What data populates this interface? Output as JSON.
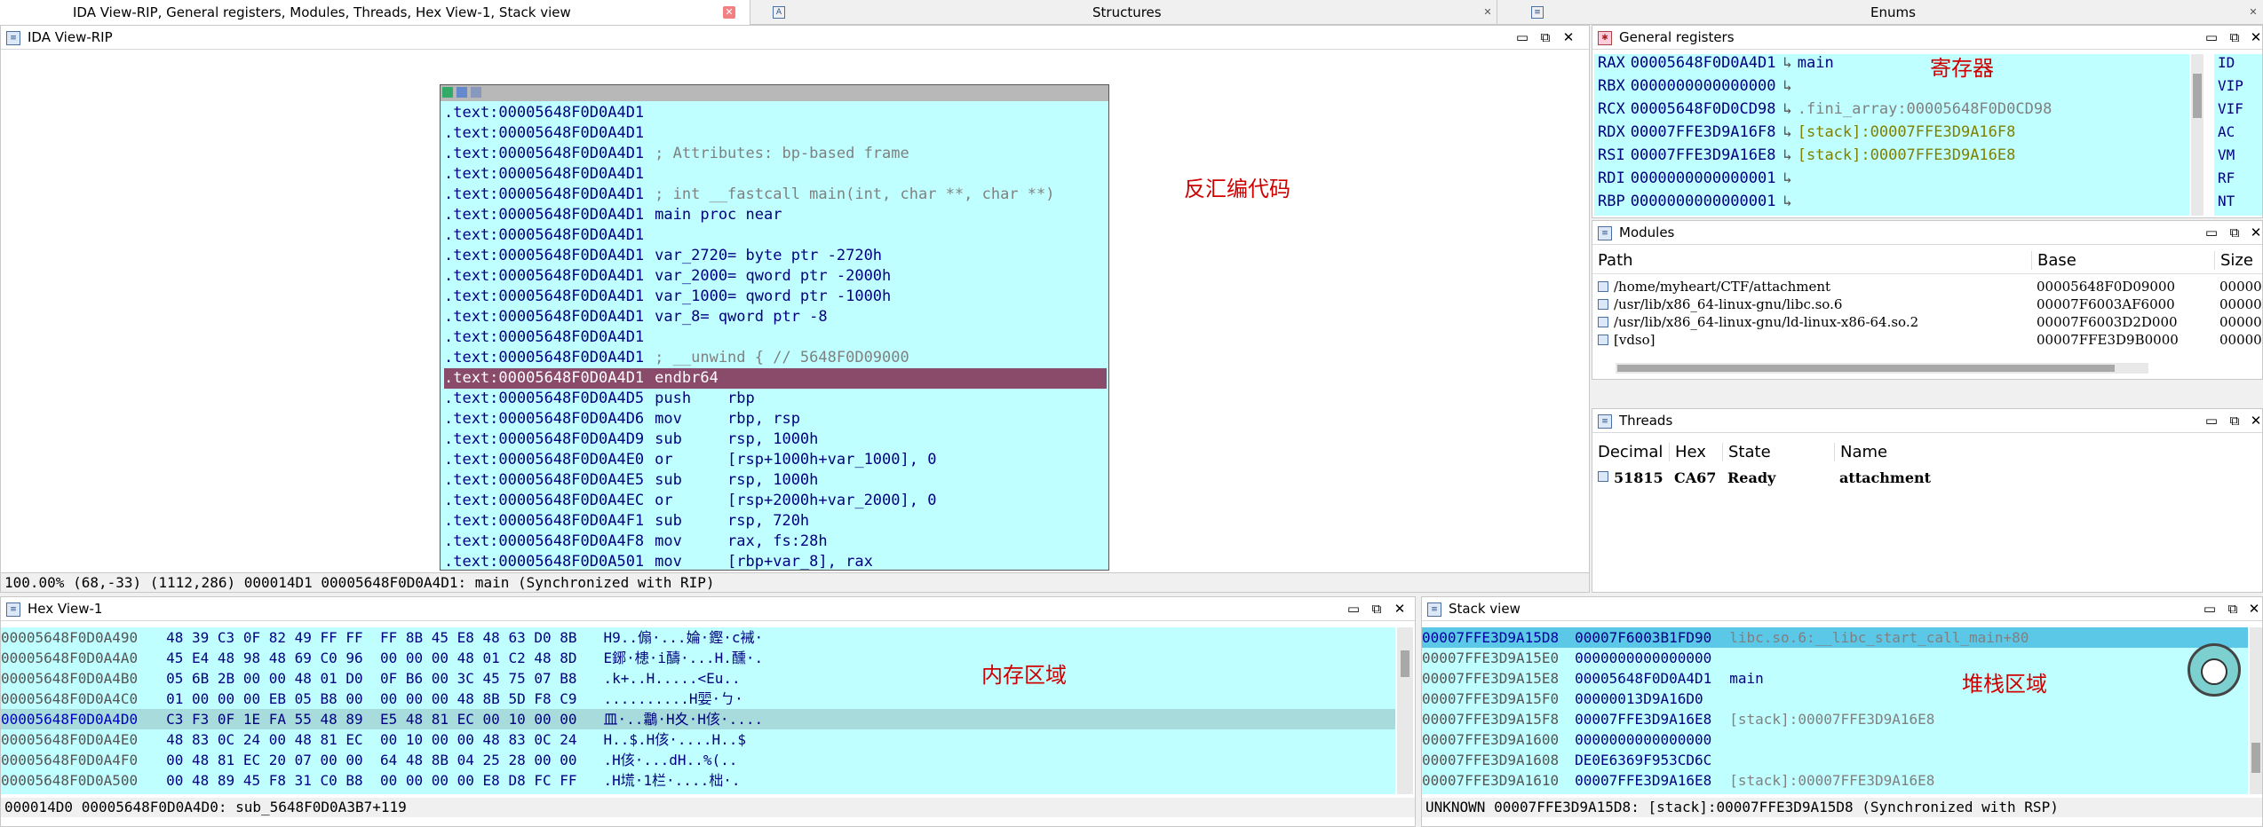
{
  "tabs": [
    {
      "label": "IDA View-RIP, General registers, Modules, Threads, Hex View-1, Stack view"
    },
    {
      "label": "Structures"
    },
    {
      "label": "Enums"
    }
  ],
  "ida_view": {
    "title": "IDA View-RIP",
    "annotation": "反汇编代码",
    "lines": [
      {
        "addr": ".text:00005648F0D0A4D1",
        "text": ""
      },
      {
        "addr": ".text:00005648F0D0A4D1",
        "text": ""
      },
      {
        "addr": ".text:00005648F0D0A4D1",
        "text": "; Attributes: bp-based frame"
      },
      {
        "addr": ".text:00005648F0D0A4D1",
        "text": ""
      },
      {
        "addr": ".text:00005648F0D0A4D1",
        "text": "; int __fastcall main(int, char **, char **)"
      },
      {
        "addr": ".text:00005648F0D0A4D1",
        "text": "main proc near"
      },
      {
        "addr": ".text:00005648F0D0A4D1",
        "text": ""
      },
      {
        "addr": ".text:00005648F0D0A4D1",
        "text": "var_2720= byte ptr -2720h"
      },
      {
        "addr": ".text:00005648F0D0A4D1",
        "text": "var_2000= qword ptr -2000h"
      },
      {
        "addr": ".text:00005648F0D0A4D1",
        "text": "var_1000= qword ptr -1000h"
      },
      {
        "addr": ".text:00005648F0D0A4D1",
        "text": "var_8= qword ptr -8"
      },
      {
        "addr": ".text:00005648F0D0A4D1",
        "text": ""
      },
      {
        "addr": ".text:00005648F0D0A4D1",
        "text": "; __unwind { // 5648F0D09000"
      },
      {
        "addr": ".text:00005648F0D0A4D1",
        "text": "endbr64"
      },
      {
        "addr": ".text:00005648F0D0A4D5",
        "text": "push    rbp"
      },
      {
        "addr": ".text:00005648F0D0A4D6",
        "text": "mov     rbp, rsp"
      },
      {
        "addr": ".text:00005648F0D0A4D9",
        "text": "sub     rsp, 1000h"
      },
      {
        "addr": ".text:00005648F0D0A4E0",
        "text": "or      [rsp+1000h+var_1000], 0"
      },
      {
        "addr": ".text:00005648F0D0A4E5",
        "text": "sub     rsp, 1000h"
      },
      {
        "addr": ".text:00005648F0D0A4EC",
        "text": "or      [rsp+2000h+var_2000], 0"
      },
      {
        "addr": ".text:00005648F0D0A4F1",
        "text": "sub     rsp, 720h"
      },
      {
        "addr": ".text:00005648F0D0A4F8",
        "text": "mov     rax, fs:28h"
      },
      {
        "addr": ".text:00005648F0D0A501",
        "text": "mov     [rbp+var_8], rax"
      }
    ],
    "status": "100.00% (68,-33) (1112,286) 000014D1 00005648F0D0A4D1: main (Synchronized with RIP)"
  },
  "registers": {
    "title": "General registers",
    "annotation": "寄存器",
    "rows": [
      {
        "name": "RAX",
        "value": "00005648F0D0A4D1",
        "arrow": "↳",
        "ref": "main"
      },
      {
        "name": "RBX",
        "value": "0000000000000000",
        "arrow": "↳",
        "ref": ""
      },
      {
        "name": "RCX",
        "value": "00005648F0D0CD98",
        "arrow": "↳",
        "ref": ".fini_array:00005648F0D0CD98"
      },
      {
        "name": "RDX",
        "value": "00007FFE3D9A16F8",
        "arrow": "↳",
        "ref": "[stack]:00007FFE3D9A16F8"
      },
      {
        "name": "RSI",
        "value": "00007FFE3D9A16E8",
        "arrow": "↳",
        "ref": "[stack]:00007FFE3D9A16E8"
      },
      {
        "name": "RDI",
        "value": "0000000000000001",
        "arrow": "↳",
        "ref": ""
      },
      {
        "name": "RBP",
        "value": "0000000000000001",
        "arrow": "↳",
        "ref": ""
      }
    ],
    "flags": [
      "ID",
      "VIP",
      "VIF",
      "AC",
      "VM",
      "RF",
      "NT"
    ]
  },
  "modules": {
    "title": "Modules",
    "columns": [
      "Path",
      "Base",
      "Size"
    ],
    "rows": [
      {
        "path": "/home/myheart/CTF/attachment",
        "base": "00005648F0D09000",
        "size": "00000"
      },
      {
        "path": "/usr/lib/x86_64-linux-gnu/libc.so.6",
        "base": "00007F6003AF6000",
        "size": "00000"
      },
      {
        "path": "/usr/lib/x86_64-linux-gnu/ld-linux-x86-64.so.2",
        "base": "00007F6003D2D000",
        "size": "00000"
      },
      {
        "path": "[vdso]",
        "base": "00007FFE3D9B0000",
        "size": "00000"
      }
    ]
  },
  "threads": {
    "title": "Threads",
    "columns": [
      "Decimal",
      "Hex",
      "State",
      "Name"
    ],
    "rows": [
      {
        "decimal": "51815",
        "hex": "CA67",
        "state": "Ready",
        "name": "attachment"
      }
    ]
  },
  "hex_view": {
    "title": "Hex View-1",
    "annotation": "内存区域",
    "rows": [
      {
        "addr": "00005648F0D0A490",
        "bytes": "48 39 C3 0F 82 49 FF FF  FF 8B 45 E8 48 63 D0 8B",
        "ascii": "H9..傓·...婨·鏗·c裓·"
      },
      {
        "addr": "00005648F0D0A4A0",
        "bytes": "45 E4 48 98 48 69 C0 96  00 00 00 48 01 C2 48 8D",
        "ascii": "E鋣·槵·i醻·...H.醺·."
      },
      {
        "addr": "00005648F0D0A4B0",
        "bytes": "05 6B 2B 00 00 48 01 D0  0F B6 00 3C 45 75 07 B8",
        "ascii": ".k+..H.....<Eu.."
      },
      {
        "addr": "00005648F0D0A4C0",
        "bytes": "01 00 00 00 EB 05 B8 00  00 00 00 48 8B 5D F8 C9",
        "ascii": "..........H婯·ㄅ·"
      },
      {
        "addr": "00005648F0D0A4D0",
        "bytes": "C3 F3 0F 1E FA 55 48 89  E5 48 81 EC 00 10 00 00",
        "ascii": "皿·..鸘·H夊·H侅·...."
      },
      {
        "addr": "00005648F0D0A4E0",
        "bytes": "48 83 0C 24 00 48 81 EC  00 10 00 00 48 83 0C 24",
        "ascii": "H..$.H侅·....H..$"
      },
      {
        "addr": "00005648F0D0A4F0",
        "bytes": "00 48 81 EC 20 07 00 00  64 48 8B 04 25 28 00 00",
        "ascii": ".H侅·...dH..%(.."
      },
      {
        "addr": "00005648F0D0A500",
        "bytes": "00 48 89 45 F8 31 C0 B8  00 00 00 00 E8 D8 FC FF",
        "ascii": ".H塃·1栏·....柮·."
      }
    ],
    "status": "000014D0 00005648F0D0A4D0: sub_5648F0D0A3B7+119"
  },
  "stack_view": {
    "title": "Stack view",
    "annotation": "堆栈区域",
    "rows": [
      {
        "addr": "00007FFE3D9A15D8",
        "value": "00007F6003B1FD90",
        "ref": "libc.so.6:__libc_start_call_main+80"
      },
      {
        "addr": "00007FFE3D9A15E0",
        "value": "0000000000000000",
        "ref": ""
      },
      {
        "addr": "00007FFE3D9A15E8",
        "value": "00005648F0D0A4D1",
        "ref": "main"
      },
      {
        "addr": "00007FFE3D9A15F0",
        "value": "00000013D9A16D0",
        "ref": ""
      },
      {
        "addr": "00007FFE3D9A15F8",
        "value": "00007FFE3D9A16E8",
        "ref": "[stack]:00007FFE3D9A16E8"
      },
      {
        "addr": "00007FFE3D9A1600",
        "value": "0000000000000000",
        "ref": ""
      },
      {
        "addr": "00007FFE3D9A1608",
        "value": "DE0E6369F953CD6C",
        "ref": ""
      },
      {
        "addr": "00007FFE3D9A1610",
        "value": "00007FFE3D9A16E8",
        "ref": "[stack]:00007FFE3D9A16E8"
      }
    ],
    "status": "UNKNOWN 00007FFE3D9A15D8: [stack]:00007FFE3D9A15D8 (Synchronized with RSP)"
  },
  "window_buttons": {
    "minimize": "▭",
    "restore": "⧉",
    "close": "✕"
  },
  "colors": {
    "panel_bg": "#c0ffff",
    "highlight_row": "#8a4a6a",
    "annotation": "#d00000"
  }
}
